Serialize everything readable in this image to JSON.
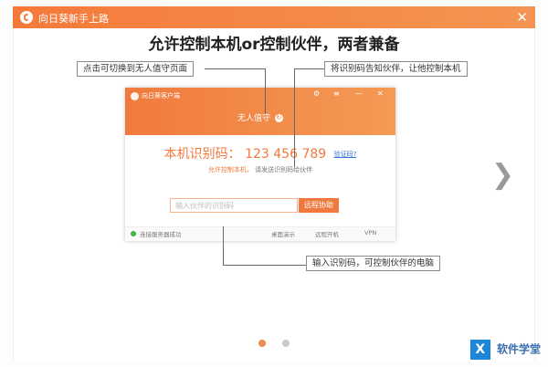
{
  "window": {
    "title": "向日葵新手上路",
    "close_label": "✕"
  },
  "headline": "允许控制本机or控制伙伴，两者兼备",
  "callouts": {
    "switch": "点击可切换到无人值守页面",
    "tell": "将识别码告知伙伴，让他控制本机",
    "input": "输入识别码，可控制伙伴的电脑"
  },
  "client": {
    "title": "向日葵客户端",
    "gear": "⚙",
    "menu": "≡",
    "minimize": "—",
    "close": "✕",
    "tab": "无人值守",
    "id_label": "本机识别码：",
    "id_value": "123 456 789",
    "verify_link": "验证码?",
    "hint_prefix": "允许控制本机，",
    "hint_rest": "请发送识别码给伙伴",
    "partner_placeholder": "输入伙伴的识别码",
    "remote_button": "远程协助",
    "status": "连接服务器成功",
    "footer_items": [
      "桌面演示",
      "远程开机",
      "VPN"
    ]
  },
  "nav": {
    "next_icon": "chevron-right-icon"
  },
  "pager": {
    "current": 1,
    "total": 2
  },
  "watermark": {
    "icon": "X",
    "text": "软件学堂"
  }
}
